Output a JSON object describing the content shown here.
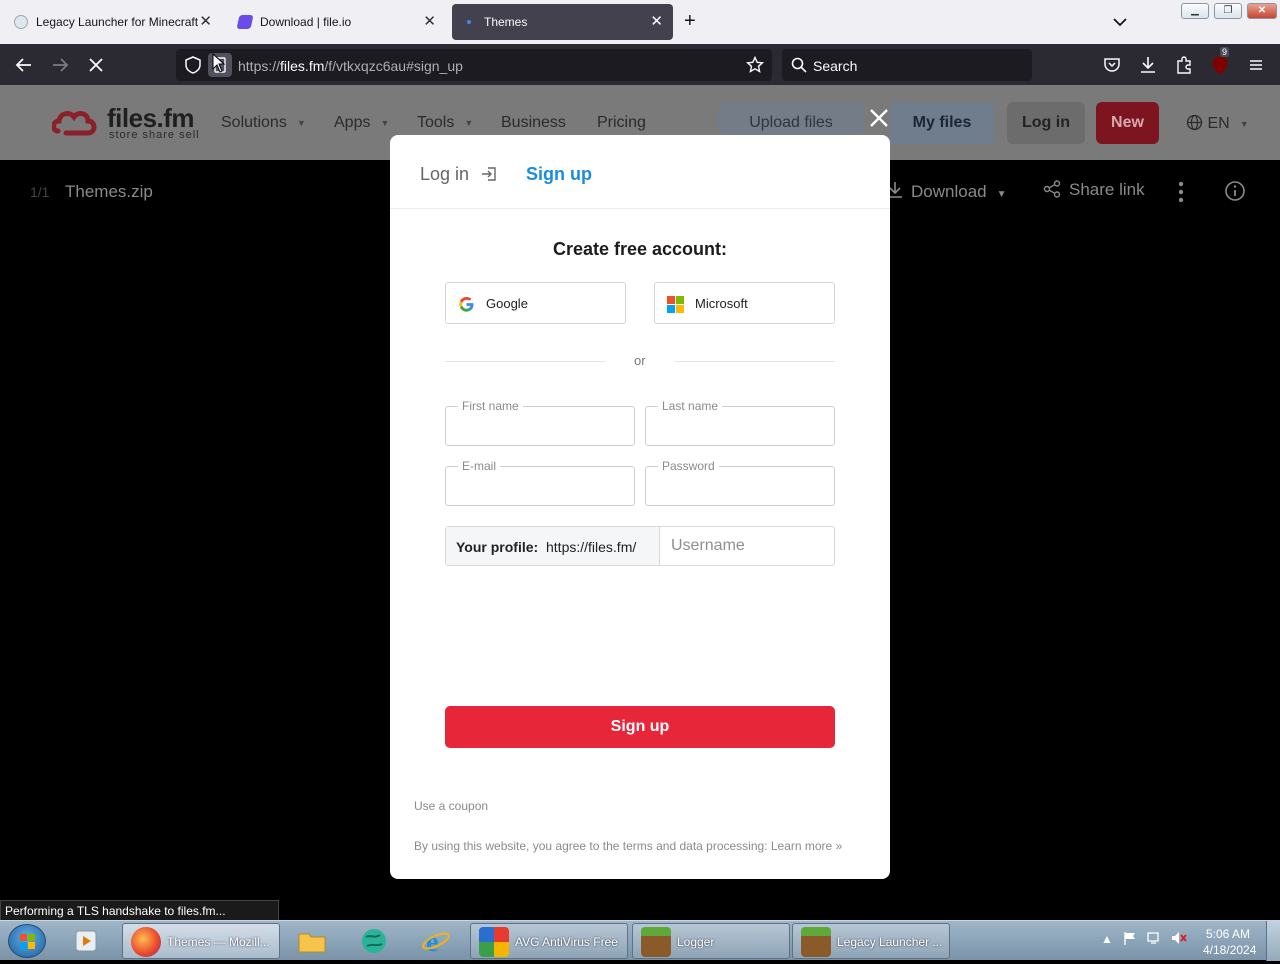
{
  "browser": {
    "tabs": [
      {
        "title": "Legacy Launcher for Minecraft",
        "active": false
      },
      {
        "title": "Download | file.io",
        "active": false
      },
      {
        "title": "Themes",
        "active": true
      }
    ],
    "url_host": "https://files.fm",
    "url_path": "/f/vtkxqzc6au#sign_up",
    "url_prefix": "https://",
    "url_domain": "files.fm",
    "search_placeholder": "Search",
    "extension_badge": "9"
  },
  "site": {
    "logo": "files.fm",
    "tagline": "store  share  sell",
    "nav": [
      "Solutions",
      "Apps",
      "Tools",
      "Business",
      "Pricing"
    ],
    "upload_label": "Upload files",
    "my_files_label": "My files",
    "login_label": "Log in",
    "new_label": "New",
    "lang_label": "EN"
  },
  "file_bar": {
    "count": "1/1",
    "filename": "Themes.zip",
    "download_label": "Download",
    "share_label": "Share link"
  },
  "modal": {
    "tab_login": "Log in",
    "tab_signup": "Sign up",
    "title": "Create free account:",
    "google_label": "Google",
    "microsoft_label": "Microsoft",
    "or_label": "or",
    "first_name_label": "First name",
    "last_name_label": "Last name",
    "email_label": "E-mail",
    "password_label": "Password",
    "profile_label": "Your profile:",
    "profile_url": "https://files.fm/",
    "username_placeholder": "Username",
    "signup_button": "Sign up",
    "coupon_link": "Use a coupon",
    "terms_text": "By using this website, you agree to the terms and data processing: Learn more »"
  },
  "status_text": "Performing a TLS handshake to files.fm...",
  "taskbar": {
    "items": [
      "Themes — Mozill...",
      "AVG AntiVirus Free",
      "Logger",
      "Legacy Launcher ..."
    ],
    "time": "5:06 AM",
    "date": "4/18/2024"
  },
  "colors": {
    "accent_red": "#e8263a",
    "link_blue": "#1a8be0",
    "browser_chrome": "#2b2a33"
  }
}
